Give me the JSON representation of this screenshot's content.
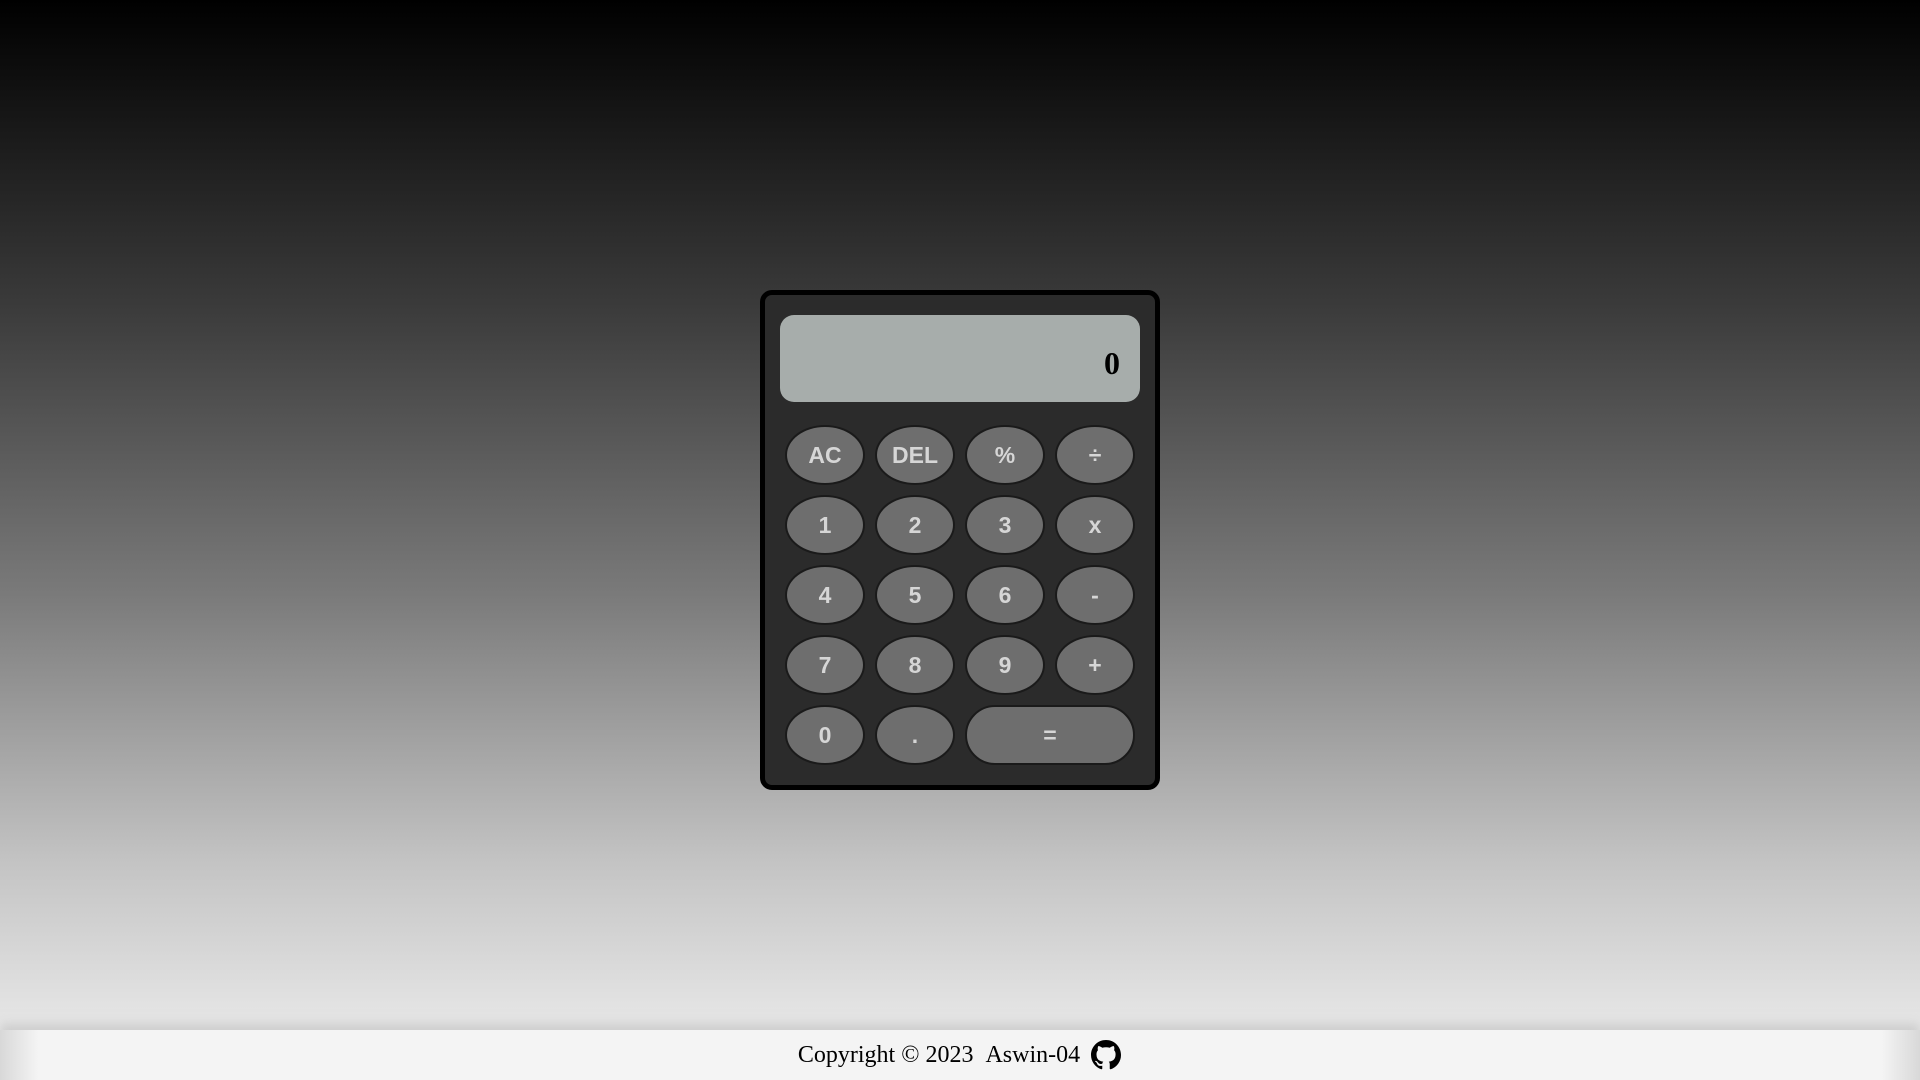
{
  "display": {
    "value": "0"
  },
  "keys": [
    {
      "label": "AC",
      "name": "clear-button"
    },
    {
      "label": "DEL",
      "name": "delete-button"
    },
    {
      "label": "%",
      "name": "percent-button"
    },
    {
      "label": "÷",
      "name": "divide-button"
    },
    {
      "label": "1",
      "name": "digit-1-button"
    },
    {
      "label": "2",
      "name": "digit-2-button"
    },
    {
      "label": "3",
      "name": "digit-3-button"
    },
    {
      "label": "x",
      "name": "multiply-button"
    },
    {
      "label": "4",
      "name": "digit-4-button"
    },
    {
      "label": "5",
      "name": "digit-5-button"
    },
    {
      "label": "6",
      "name": "digit-6-button"
    },
    {
      "label": "-",
      "name": "subtract-button"
    },
    {
      "label": "7",
      "name": "digit-7-button"
    },
    {
      "label": "8",
      "name": "digit-8-button"
    },
    {
      "label": "9",
      "name": "digit-9-button"
    },
    {
      "label": "+",
      "name": "add-button"
    },
    {
      "label": "0",
      "name": "digit-0-button"
    },
    {
      "label": ".",
      "name": "decimal-button"
    },
    {
      "label": "=",
      "name": "equals-button",
      "wide": true
    }
  ],
  "footer": {
    "copyright": "Copyright © 2023",
    "author": "Aswin-04",
    "icon": "github-icon"
  },
  "colors": {
    "calculator_body": "#2b2b2b",
    "display_background": "#a7adab",
    "key_background": "#6e6e6e",
    "key_text": "#d6d6d6"
  }
}
